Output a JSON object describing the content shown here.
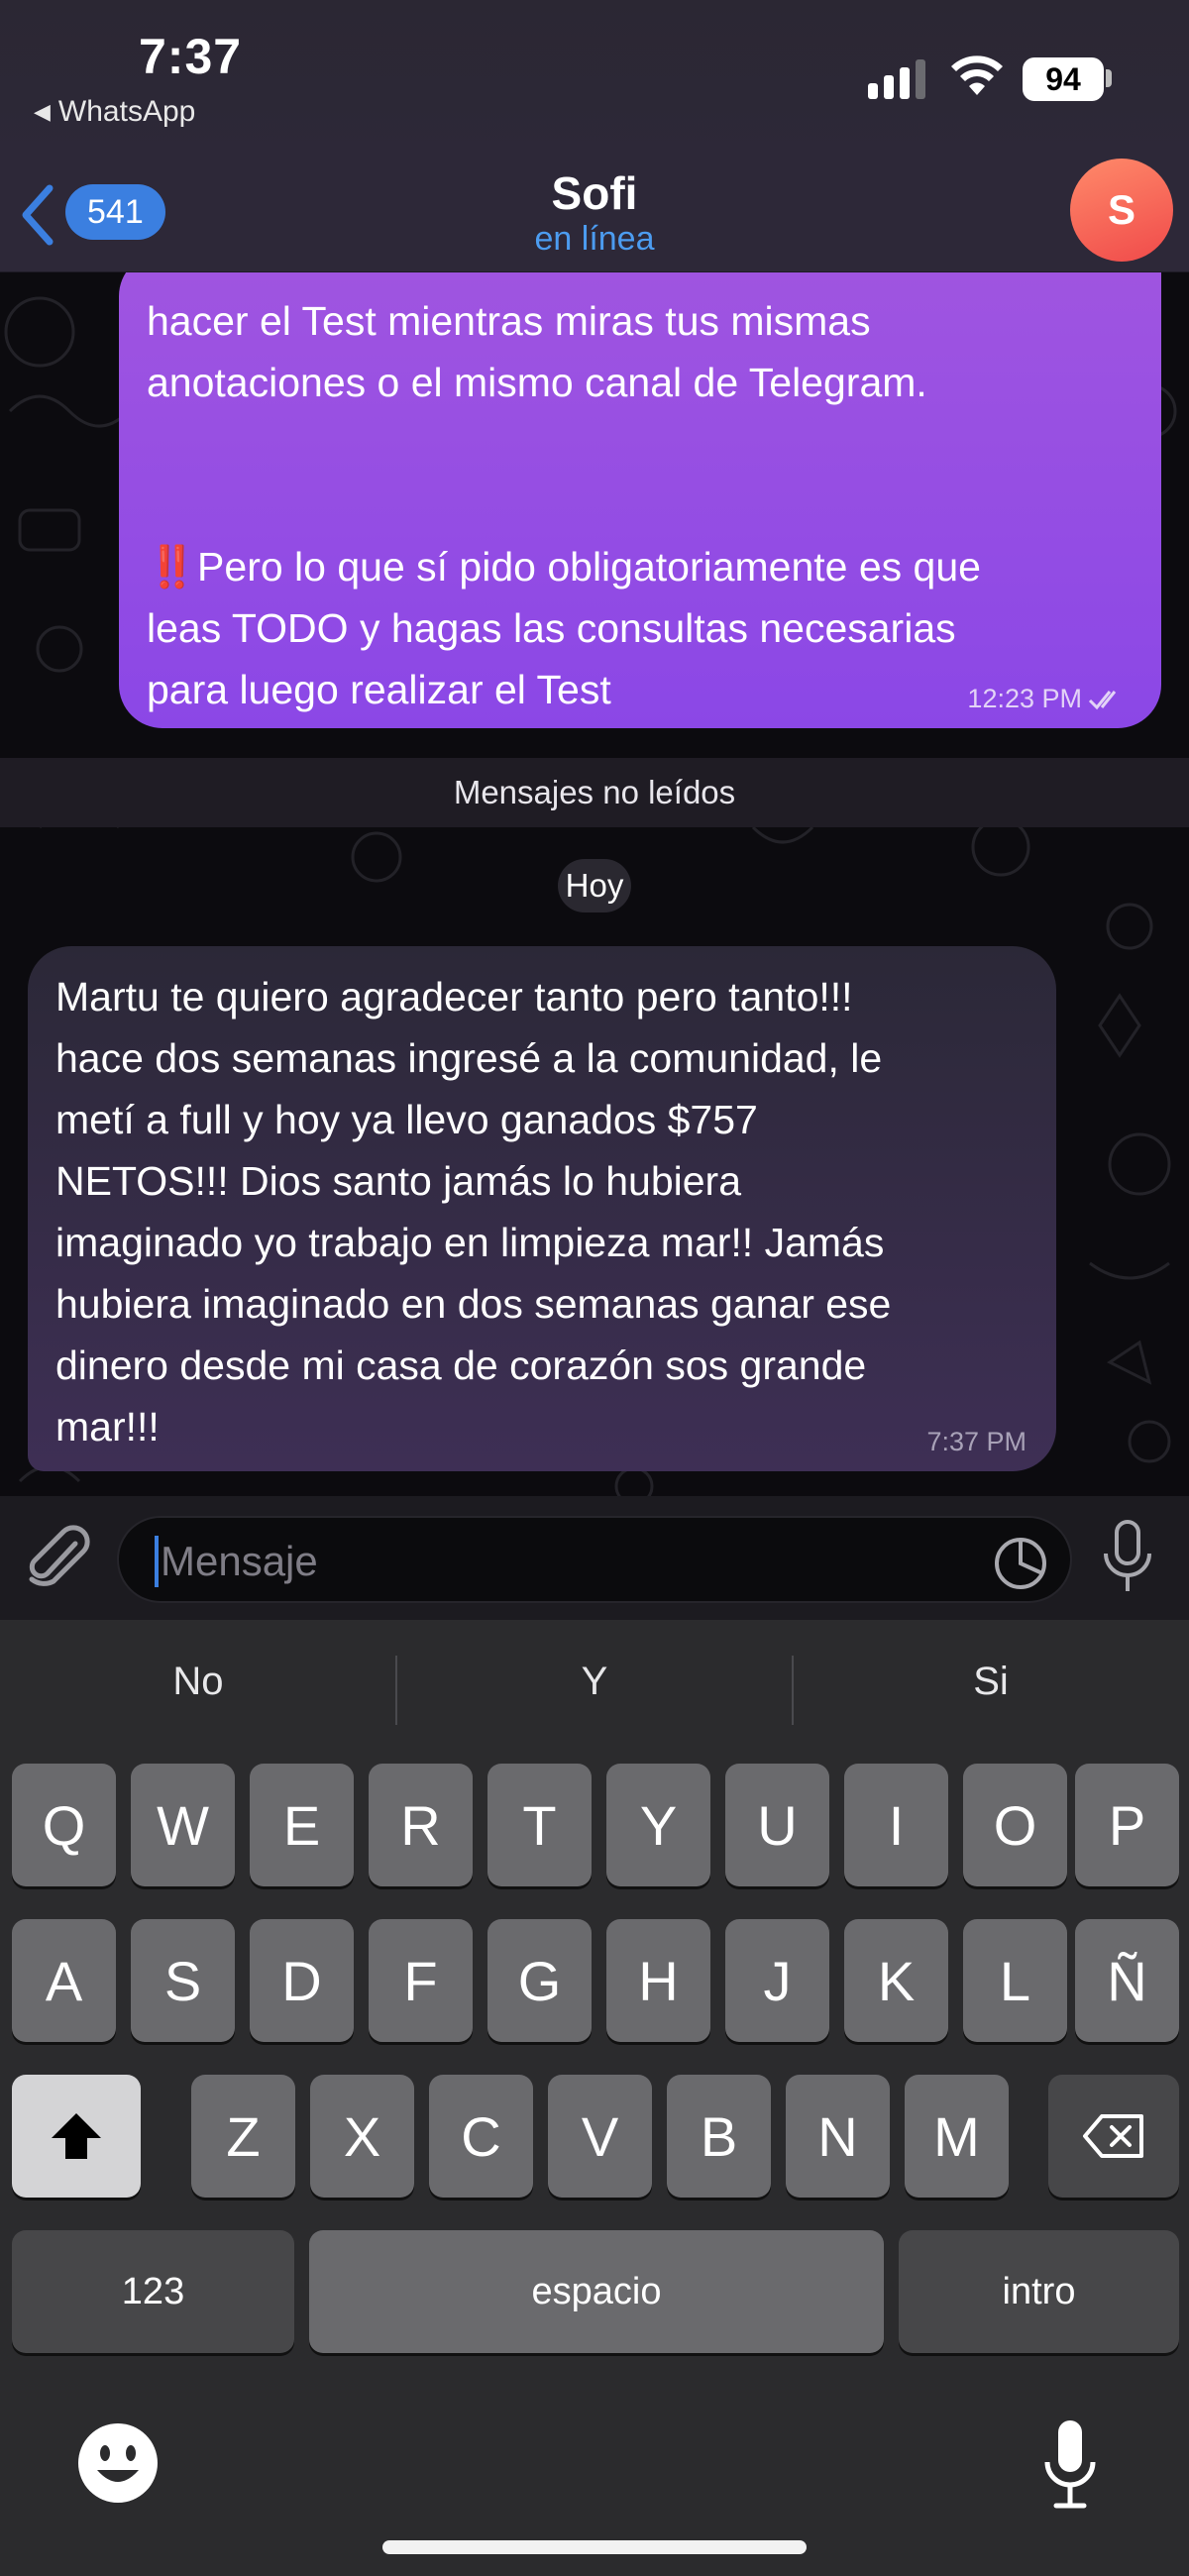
{
  "status_bar": {
    "time": "7:37",
    "back_app": "WhatsApp",
    "battery": "94",
    "signal_bars_filled": 3
  },
  "header": {
    "unread_count": "541",
    "name": "Sofi",
    "status": "en línea",
    "avatar_letter": "S"
  },
  "messages": {
    "outgoing": {
      "lines": [
        "hacer el Test mientras miras tus mismas",
        "anotaciones o el mismo canal de Telegram.",
        "",
        "",
        "‼️Pero lo que sí pido obligatoriamente es que",
        "leas TODO y hagas las consultas necesarias",
        "para luego realizar el Test"
      ],
      "time": "12:23 PM"
    },
    "unread_divider": "Mensajes no leídos",
    "date_label": "Hoy",
    "incoming": {
      "lines": [
        "Martu te quiero agradecer tanto pero tanto!!!",
        "hace dos semanas ingresé a la comunidad, le",
        "metí a full y hoy ya llevo ganados $757",
        "NETOS!!! Dios santo jamás lo hubiera",
        "imaginado yo trabajo en limpieza mar!! Jamás",
        "hubiera imaginado en dos semanas ganar ese",
        "dinero desde mi casa de corazón sos grande",
        "mar!!!"
      ],
      "time": "7:37 PM"
    }
  },
  "input": {
    "placeholder": "Mensaje"
  },
  "keyboard": {
    "suggestions": [
      "No",
      "Y",
      "Si"
    ],
    "row1": [
      "Q",
      "W",
      "E",
      "R",
      "T",
      "Y",
      "U",
      "I",
      "O",
      "P"
    ],
    "row2": [
      "A",
      "S",
      "D",
      "F",
      "G",
      "H",
      "J",
      "K",
      "L",
      "Ñ"
    ],
    "row3": [
      "Z",
      "X",
      "C",
      "V",
      "B",
      "N",
      "M"
    ],
    "numbers_key": "123",
    "space_key": "espacio",
    "return_key": "intro"
  },
  "colors": {
    "accent": "#3b7fe0",
    "outgoing_bubble": "#8b47e6",
    "incoming_bubble": "#2b2837",
    "online_status": "#4c9cf0",
    "avatar": "#f04a4a"
  }
}
